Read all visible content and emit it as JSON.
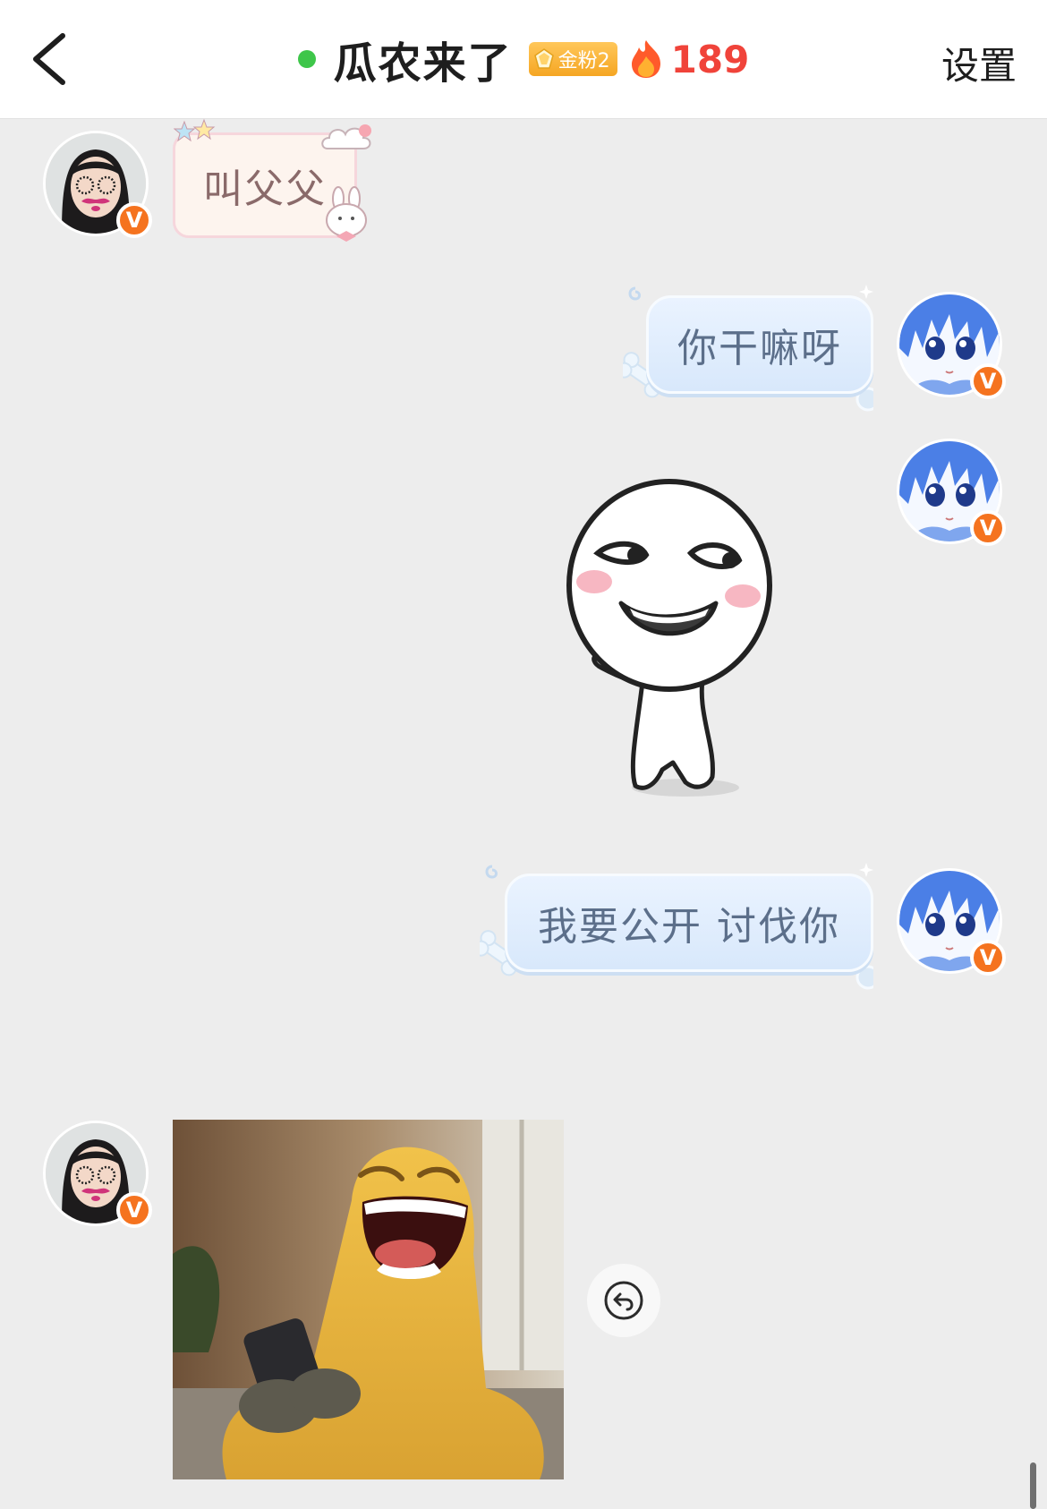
{
  "header": {
    "back_icon": "chevron-left-icon",
    "online_status_color": "#3ec64a",
    "contact_name": "瓜农来了",
    "fan_badge": "金粉2",
    "fan_badge_color": "#f5a623",
    "streak_icon": "fire-icon",
    "streak_count": "189",
    "streak_color": "#f0433a",
    "settings_label": "设置"
  },
  "messages": [
    {
      "sender": "them",
      "type": "text",
      "text": "叫父父"
    },
    {
      "sender": "me",
      "type": "text",
      "text": "你干嘛呀"
    },
    {
      "sender": "me",
      "type": "sticker",
      "sticker": "white-cartoon-smirk"
    },
    {
      "sender": "me",
      "type": "text",
      "text": "我要公开 讨伐你"
    },
    {
      "sender": "them",
      "type": "image",
      "image": "laughing-yellow-creature-holding-phone"
    }
  ],
  "message_actions": {
    "reply_icon": "reply-icon"
  },
  "avatar_badge": "V",
  "colors": {
    "background": "#ededed",
    "verified_badge": "#f5731f"
  }
}
